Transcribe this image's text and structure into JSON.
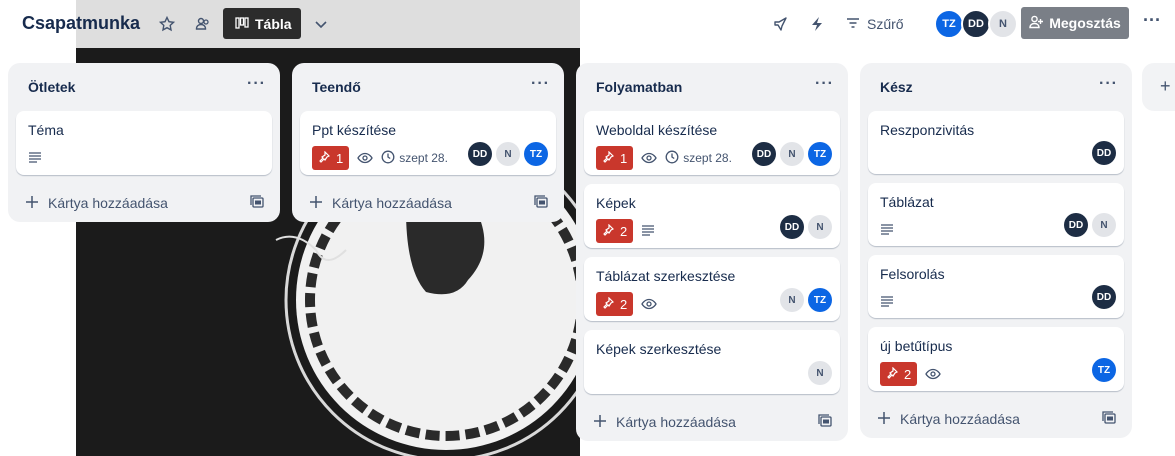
{
  "board": {
    "title": "Csapatmunka",
    "view_label": "Tábla",
    "filter_label": "Szűrő",
    "share_label": "Megosztás",
    "members": [
      "TZ",
      "DD",
      "N"
    ]
  },
  "lists": [
    {
      "title": "Ötletek",
      "cards": [
        {
          "title": "Téma",
          "description": true
        }
      ],
      "add_label": "Kártya hozzáadása"
    },
    {
      "title": "Teendő",
      "cards": [
        {
          "title": "Ppt készítése",
          "count": "1",
          "watch": true,
          "due": "szept 28.",
          "members": [
            "DD",
            "N",
            "TZ"
          ]
        }
      ],
      "add_label": "Kártya hozzáadása"
    },
    {
      "title": "Folyamatban",
      "cards": [
        {
          "title": "Weboldal készítése",
          "count": "1",
          "watch": true,
          "due": "szept 28.",
          "members": [
            "DD",
            "N",
            "TZ"
          ]
        },
        {
          "title": "Képek",
          "count": "2",
          "description": true,
          "members": [
            "DD",
            "N"
          ]
        },
        {
          "title": "Táblázat szerkesztése",
          "count": "2",
          "watch": true,
          "members": [
            "N",
            "TZ"
          ]
        },
        {
          "title": "Képek szerkesztése",
          "members": [
            "N"
          ]
        }
      ],
      "add_label": "Kártya hozzáadása"
    },
    {
      "title": "Kész",
      "cards": [
        {
          "title": "Reszponzivitás",
          "members": [
            "DD"
          ]
        },
        {
          "title": "Táblázat",
          "description": true,
          "members": [
            "DD",
            "N"
          ]
        },
        {
          "title": "Felsorolás",
          "description": true,
          "members": [
            "DD"
          ]
        },
        {
          "title": "új betűtípus",
          "count": "2",
          "watch": true,
          "members": [
            "TZ"
          ]
        }
      ],
      "add_label": "Kártya hozzáadása"
    }
  ],
  "colors": {
    "label_red": "#c9372c",
    "avatar_tz": "#0c66e4",
    "avatar_dd": "#1d2d44",
    "avatar_n": "#e2e4e8"
  }
}
